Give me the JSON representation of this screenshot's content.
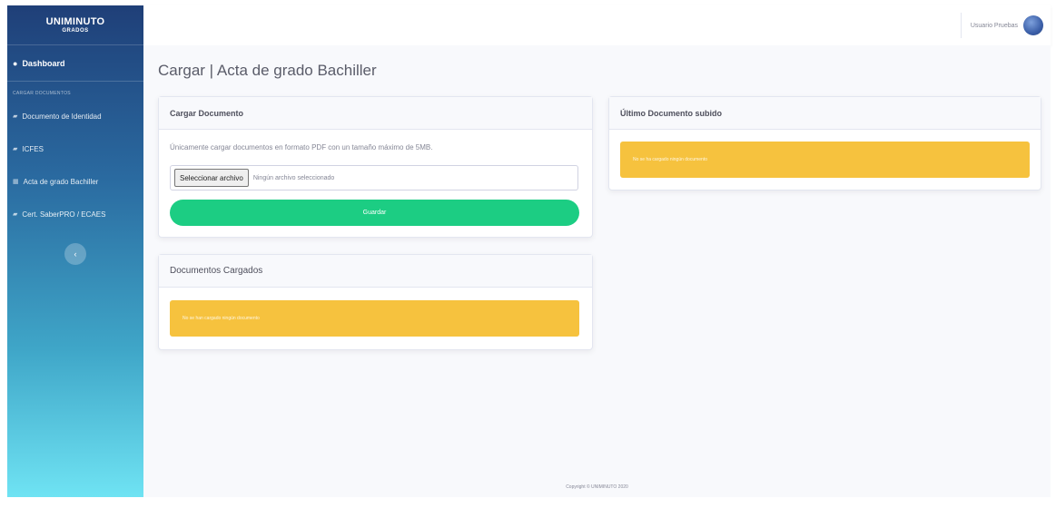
{
  "sidebar": {
    "brand_name": "UNIMINUTO",
    "brand_sub": "GRADOS",
    "dashboard_label": "Dashboard",
    "section_heading": "CARGAR DOCUMENTOS",
    "items": [
      {
        "label": "Documento de Identidad"
      },
      {
        "label": "ICFES"
      },
      {
        "label": "Acta de grado Bachiller"
      },
      {
        "label": "Cert. SaberPRO / ECAES"
      }
    ]
  },
  "topbar": {
    "user_name": "Usuario Pruebas"
  },
  "page": {
    "title": "Cargar | Acta de grado Bachiller"
  },
  "upload_card": {
    "header": "Cargar Documento",
    "help_text": "Únicamente cargar documentos en formato PDF con un tamaño máximo de 5MB.",
    "file_button": "Seleccionar archivo",
    "file_name": "Ningún archivo seleccionado",
    "save_button": "Guardar"
  },
  "loaded_card": {
    "header": "Documentos Cargados",
    "alert": "No se han cargado ningún documento"
  },
  "last_card": {
    "header": "Último Documento subido",
    "alert": "No se ha cargado ningún documento"
  },
  "footer": {
    "copyright": "Copyright © UNIMINUTO 2020"
  },
  "colors": {
    "save_button": "#1ccd83",
    "alert": "#f6c23e",
    "sidebar_top": "#1f3f78",
    "sidebar_bottom": "#6fe3f3"
  }
}
